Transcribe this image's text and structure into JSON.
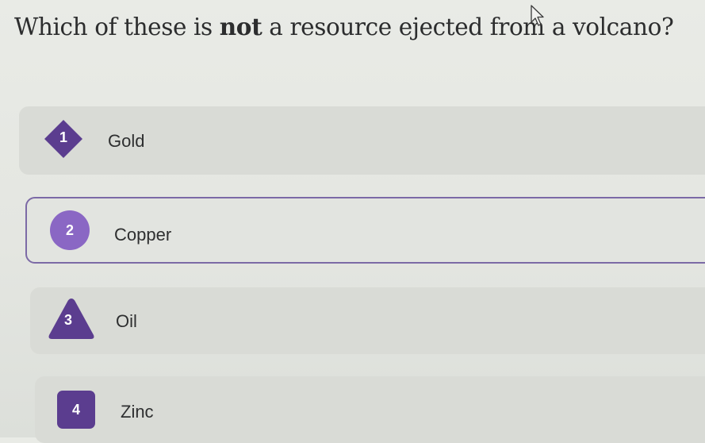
{
  "question": {
    "prefix": "Which of these is ",
    "emphasis": "not",
    "suffix": " a resource ejected from a volcano?"
  },
  "options": [
    {
      "number": "1",
      "label": "Gold",
      "shape": "diamond"
    },
    {
      "number": "2",
      "label": "Copper",
      "shape": "circle"
    },
    {
      "number": "3",
      "label": "Oil",
      "shape": "triangle"
    },
    {
      "number": "4",
      "label": "Zinc",
      "shape": "square"
    }
  ],
  "selected_option": "2",
  "colors": {
    "accent": "#5b3d8f",
    "selected_accent": "#8a67c4",
    "option_bg": "#d9dbd6",
    "page_bg": "#e6e8e3"
  },
  "icons": {
    "cursor": "mouse-pointer-icon"
  }
}
